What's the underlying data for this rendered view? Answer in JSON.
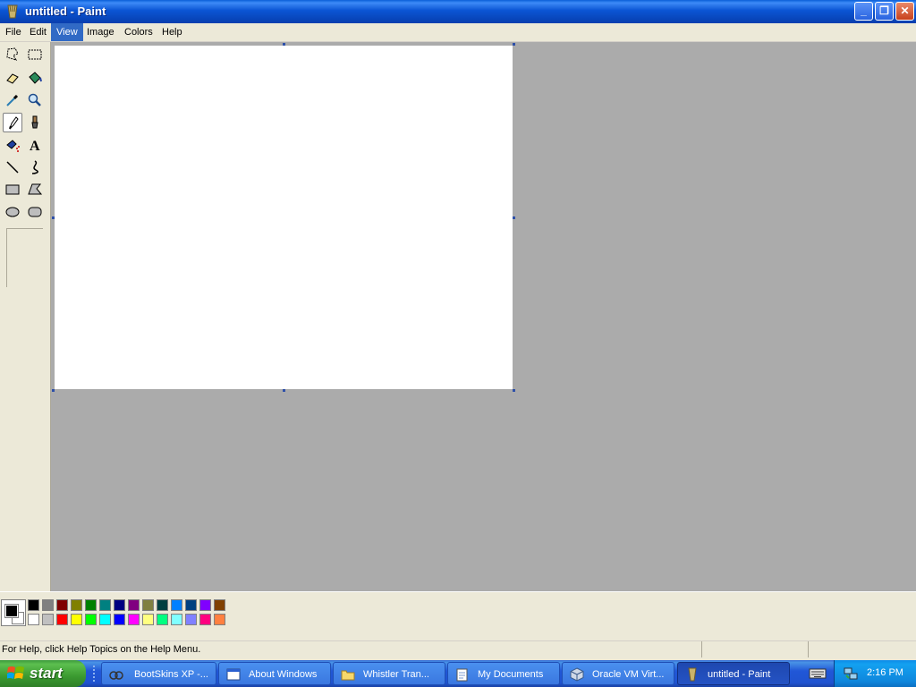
{
  "window": {
    "title": "untitled - Paint",
    "minimize_glyph": "_",
    "maximize_glyph": "❐",
    "close_glyph": "✕"
  },
  "menu": [
    {
      "label": "File"
    },
    {
      "label": "Edit"
    },
    {
      "label": "View",
      "active": true
    },
    {
      "label": "Image"
    },
    {
      "label": "Colors"
    },
    {
      "label": "Help"
    }
  ],
  "tools": [
    "free-form-select-icon",
    "select-icon",
    "eraser-icon",
    "fill-with-color-icon",
    "pick-color-icon",
    "magnifier-icon",
    "pencil-icon",
    "brush-icon",
    "airbrush-icon",
    "text-icon",
    "line-icon",
    "curve-icon",
    "rectangle-icon",
    "polygon-icon",
    "ellipse-icon",
    "rounded-rectangle-icon"
  ],
  "selected_tool": "pencil-icon",
  "text_tool_glyph": "A",
  "colors": {
    "foreground": "#000000",
    "background": "#FFFFFF",
    "palette_top": [
      "#000000",
      "#808080",
      "#800000",
      "#808000",
      "#008000",
      "#008080",
      "#000080",
      "#800080",
      "#808040",
      "#004040",
      "#0080FF",
      "#004080",
      "#8000FF",
      "#804000"
    ],
    "palette_bottom": [
      "#FFFFFF",
      "#C0C0C0",
      "#FF0000",
      "#FFFF00",
      "#00FF00",
      "#00FFFF",
      "#0000FF",
      "#FF00FF",
      "#FFFF80",
      "#00FF80",
      "#80FFFF",
      "#8080FF",
      "#FF0080",
      "#FF8040"
    ],
    "workspace": "#ABABAB",
    "accent": "#316AC5"
  },
  "status": {
    "help_text": "For Help, click Help Topics on the Help Menu."
  },
  "taskbar": {
    "start_label": "start",
    "tasks": [
      {
        "label": "BootSkins XP -...",
        "icon": "bootskins-icon"
      },
      {
        "label": "About Windows",
        "icon": "window-icon"
      },
      {
        "label": "Whistler Tran...",
        "icon": "folder-icon"
      },
      {
        "label": "My Documents",
        "icon": "documents-icon"
      },
      {
        "label": "Oracle VM Virt...",
        "icon": "virtualbox-icon"
      },
      {
        "label": "untitled - Paint",
        "icon": "paint-icon",
        "active": true
      }
    ],
    "clock": "2:16 PM"
  }
}
